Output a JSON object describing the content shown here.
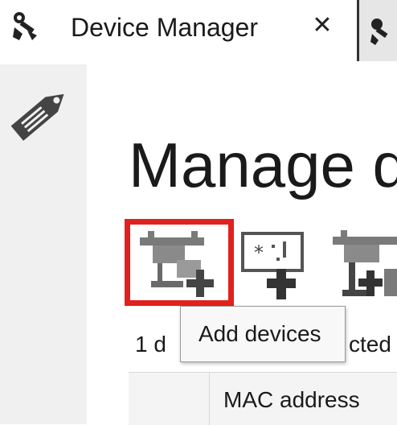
{
  "window": {
    "title": "Device Manager",
    "app_icon": "device-manager-icon",
    "close_glyph": "✕"
  },
  "page": {
    "title": "Manage d"
  },
  "toolbar": {
    "add_devices_tooltip": "Add devices",
    "buttons": [
      "add-devices-icon",
      "add-device-configuration-icon",
      "add-device-network-icon"
    ]
  },
  "status": {
    "text": "1 d",
    "suffix": "cted"
  },
  "table": {
    "columns": [
      "",
      "MAC address"
    ]
  },
  "colors": {
    "highlight": "#e0211d",
    "icon_gray": "#7a7a7a",
    "rail_bg": "#f0f0f0"
  }
}
